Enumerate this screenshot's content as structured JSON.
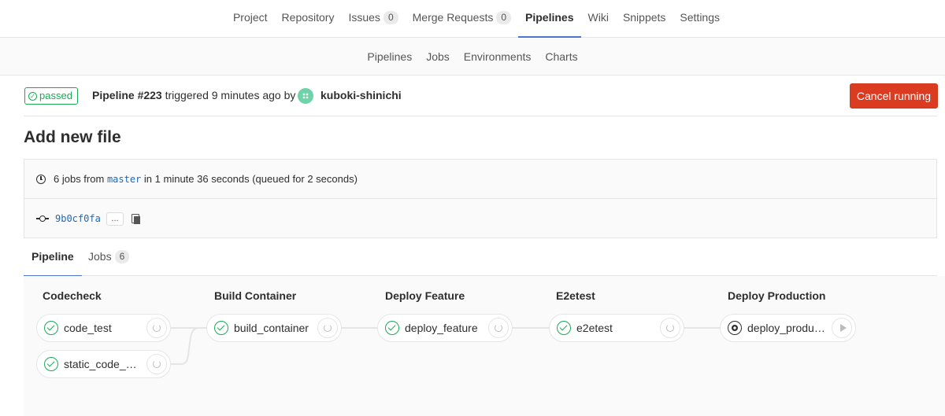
{
  "topnav": {
    "items": [
      {
        "label": "Project"
      },
      {
        "label": "Repository"
      },
      {
        "label": "Issues",
        "badge": "0"
      },
      {
        "label": "Merge Requests",
        "badge": "0"
      },
      {
        "label": "Pipelines",
        "active": true
      },
      {
        "label": "Wiki"
      },
      {
        "label": "Snippets"
      },
      {
        "label": "Settings"
      }
    ]
  },
  "subnav": {
    "items": [
      "Pipelines",
      "Jobs",
      "Environments",
      "Charts"
    ]
  },
  "pipeline": {
    "status": "passed",
    "id_label": "Pipeline #223",
    "triggered_text": "triggered 9 minutes ago by",
    "user": "kuboki-shinichi",
    "cancel_label": "Cancel running",
    "title": "Add new file",
    "jobs_prefix": "6 jobs from",
    "branch": "master",
    "jobs_suffix": "in 1 minute 36 seconds (queued for 2 seconds)",
    "sha": "9b0cf0fa",
    "ellipsis": "..."
  },
  "tabs": {
    "pipeline_label": "Pipeline",
    "jobs_label": "Jobs",
    "jobs_count": "6"
  },
  "colors": {
    "success": "#1aaa55",
    "danger": "#db3b21",
    "accent": "#4a76d0"
  },
  "stages": [
    {
      "name": "Codecheck",
      "jobs": [
        {
          "name": "code_test",
          "status": "success",
          "action": "retry-icon"
        },
        {
          "name": "static_code_an...",
          "status": "success",
          "action": "retry-icon"
        }
      ]
    },
    {
      "name": "Build Container",
      "jobs": [
        {
          "name": "build_container",
          "status": "success",
          "action": "retry-icon"
        }
      ]
    },
    {
      "name": "Deploy Feature",
      "jobs": [
        {
          "name": "deploy_feature",
          "status": "success",
          "action": "retry-icon"
        }
      ]
    },
    {
      "name": "E2etest",
      "jobs": [
        {
          "name": "e2etest",
          "status": "success",
          "action": "retry-icon"
        }
      ]
    },
    {
      "name": "Deploy Production",
      "jobs": [
        {
          "name": "deploy_produc...",
          "status": "manual",
          "action": "play-icon"
        }
      ]
    }
  ]
}
